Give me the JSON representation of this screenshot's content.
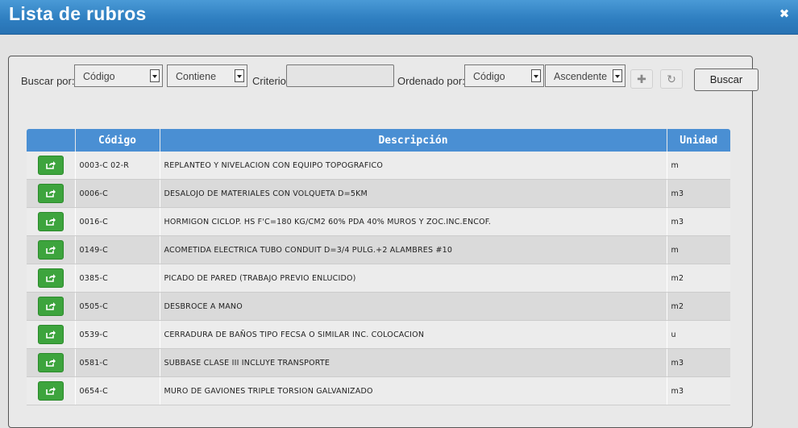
{
  "window": {
    "title": "Lista de rubros"
  },
  "toolbar": {
    "buscar_por_label": "Buscar por:",
    "buscar_por_value": "Código",
    "condicion_value": "Contiene",
    "criterio_label": "Criterio:",
    "criterio_value": "",
    "ordenado_por_label": "Ordenado por:",
    "ordenado_por_value": "Código",
    "orden_value": "Ascendente",
    "buscar_button": "Buscar"
  },
  "table": {
    "headers": [
      "",
      "Código",
      "Descripción",
      "Unidad"
    ],
    "rows": [
      {
        "codigo": "0003-C 02-R",
        "descripcion": "REPLANTEO Y NIVELACION CON EQUIPO TOPOGRAFICO",
        "unidad": "m"
      },
      {
        "codigo": "0006-C",
        "descripcion": "DESALOJO DE MATERIALES CON VOLQUETA D=5KM",
        "unidad": "m3"
      },
      {
        "codigo": "0016-C",
        "descripcion": "HORMIGON CICLOP. HS F'C=180 KG/CM2 60% PDA 40% MUROS Y ZOC.INC.ENCOF.",
        "unidad": "m3"
      },
      {
        "codigo": "0149-C",
        "descripcion": "ACOMETIDA ELECTRICA TUBO CONDUIT D=3/4 PULG.+2 ALAMBRES #10",
        "unidad": "m"
      },
      {
        "codigo": "0385-C",
        "descripcion": "PICADO DE PARED (TRABAJO PREVIO ENLUCIDO)",
        "unidad": "m2"
      },
      {
        "codigo": "0505-C",
        "descripcion": "DESBROCE A MANO",
        "unidad": "m2"
      },
      {
        "codigo": "0539-C",
        "descripcion": "CERRADURA DE BAÑOS TIPO FECSA O SIMILAR INC. COLOCACION",
        "unidad": "u"
      },
      {
        "codigo": "0581-C",
        "descripcion": "SUBBASE CLASE III INCLUYE TRANSPORTE",
        "unidad": "m3"
      },
      {
        "codigo": "0654-C",
        "descripcion": "MURO DE GAVIONES TRIPLE TORSION GALVANIZADO",
        "unidad": "m3"
      }
    ]
  },
  "icons": {
    "close": "close-icon",
    "add": "plus-icon",
    "refresh": "refresh-icon",
    "select_row": "share-icon"
  },
  "colors": {
    "titlebar": "#2f7fc1",
    "header": "#4a8fd3",
    "select_button": "#3da43d"
  }
}
